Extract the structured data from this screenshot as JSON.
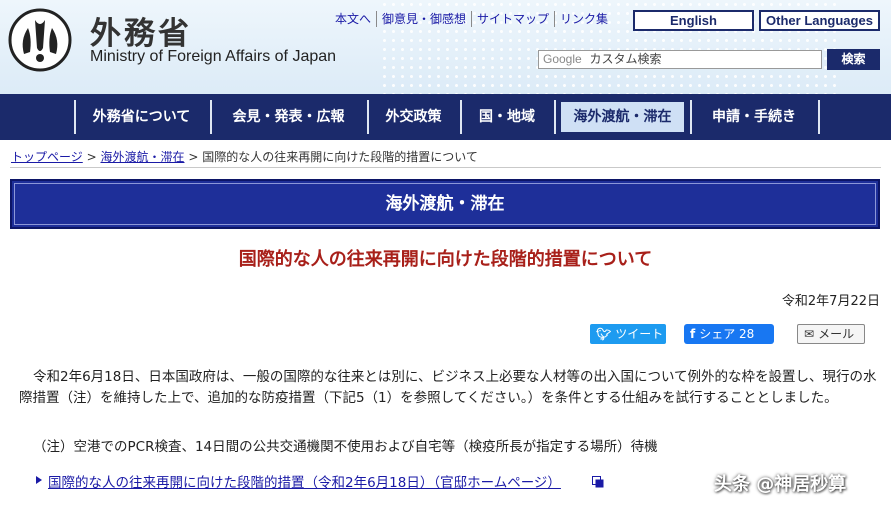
{
  "header": {
    "title_jp": "外務省",
    "title_en": "Ministry of Foreign Affairs of Japan",
    "util_links": [
      "本文へ",
      "御意見・御感想",
      "サイトマップ",
      "リンク集"
    ],
    "lang_english": "English",
    "lang_other": "Other Languages",
    "search_google": "Google",
    "search_placeholder": "カスタム検索",
    "search_button": "検索",
    "colors": {
      "navy": "#1b2a6b",
      "header_bg": "#dcebf7",
      "link": "#1a1aa6"
    }
  },
  "nav": {
    "items": [
      "外務省について",
      "会見・発表・広報",
      "外交政策",
      "国・地域",
      "海外渡航・滞在",
      "申請・手続き"
    ],
    "active": "海外渡航・滞在"
  },
  "breadcrumb": {
    "items": [
      "トップページ",
      "海外渡航・滞在",
      "国際的な人の往来再開に向けた段階的措置について"
    ],
    "separator": ">"
  },
  "section_title": "海外渡航・滞在",
  "page_heading": "国際的な人の往来再開に向けた段階的措置について",
  "date": "令和2年7月22日",
  "share": {
    "twitter": "ツイート",
    "facebook": "シェア 28",
    "mail": "メール"
  },
  "body": {
    "paragraph": "令和2年6月18日、日本国政府は、一般の国際的な往来とは別に、ビジネス上必要な人材等の出入国について例外的な枠を設置し、現行の水際措置（注）を維持した上で、追加的な防疫措置（下記5（1）を参照してください。）を条件とする仕組みを試行することとしました。",
    "note": "（注）空港でのPCR検査、14日間の公共交通機関不使用および自宅等（検疫所長が指定する場所）待機",
    "link": "国際的な人の往来再開に向けた段階的措置（令和2年6月18日）（官邸ホームページ）"
  },
  "watermark": "头条 @神居秒算"
}
